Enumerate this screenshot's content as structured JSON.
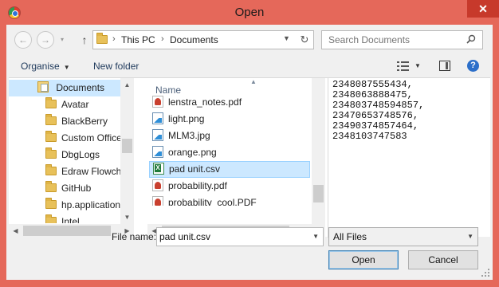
{
  "window": {
    "title": "Open",
    "close_glyph": "✕"
  },
  "address": {
    "crumbs": [
      "This PC",
      "Documents"
    ],
    "back_glyph": "←",
    "forward_glyph": "→",
    "up_glyph": "↑",
    "refresh_glyph": "↻"
  },
  "search": {
    "placeholder": "Search Documents"
  },
  "commands": {
    "organise": "Organise",
    "new_folder": "New folder",
    "help_glyph": "?"
  },
  "nav_tree": {
    "root": "Documents",
    "items": [
      "Avatar",
      "BlackBerry",
      "Custom Office Templates",
      "DbgLogs",
      "Edraw Flowchart",
      "GitHub",
      "hp.applications",
      "Intel"
    ]
  },
  "file_list": {
    "column_name": "Name",
    "rows": [
      {
        "name": "lenstra_notes.pdf",
        "icon": "pdf-icon"
      },
      {
        "name": "light.png",
        "icon": "image-icon"
      },
      {
        "name": "MLM3.jpg",
        "icon": "image-icon"
      },
      {
        "name": "orange.png",
        "icon": "image-icon"
      },
      {
        "name": "pad unit.csv",
        "icon": "excel-csv-icon",
        "selected": true
      },
      {
        "name": "probability.pdf",
        "icon": "pdf-icon"
      },
      {
        "name": "probability_cool.PDF",
        "icon": "pdf-icon"
      }
    ]
  },
  "preview": {
    "lines": [
      "2348087555434,",
      "2348063888475,",
      "234803748594857,",
      "23470653748576,",
      "23490374857464,",
      "2348103747583"
    ]
  },
  "bottom": {
    "file_name_label": "File name:",
    "file_name_value": "pad unit.csv",
    "file_type_value": "All Files",
    "open_label": "Open",
    "cancel_label": "Cancel"
  },
  "colors": {
    "title_bar": "#e5685a",
    "close_button": "#c7392b",
    "selection": "#cce8ff",
    "dialog_bg": "#f0f0f0"
  }
}
